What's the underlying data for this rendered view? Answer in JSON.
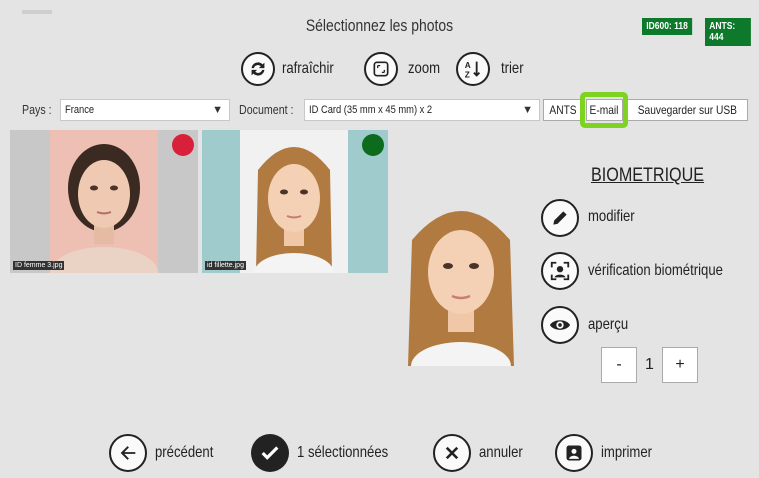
{
  "header": {
    "title": "Sélectionnez les photos",
    "badge_id600": "ID600: 118",
    "badge_ants": "ANTS: 444"
  },
  "toolbar": {
    "refresh_label": "rafraîchir",
    "zoom_label": "zoom",
    "sort_label": "trier"
  },
  "filters": {
    "country_label": "Pays :",
    "country_value": "France",
    "document_label": "Document :",
    "document_value": "ID Card (35 mm x 45 mm) x 2",
    "ants_button": "ANTS",
    "email_button": "E-mail",
    "usb_button": "Sauvegarder sur USB"
  },
  "thumbnails": [
    {
      "caption": "ID femme 3.jpg",
      "status_color": "#d9203a"
    },
    {
      "caption": "id fillette.jpg",
      "status_color": "#0c6b1c"
    }
  ],
  "panel": {
    "section_title": "BIOMETRIQUE",
    "edit_label": "modifier",
    "bio_check_label": "vérification biométrique",
    "preview_label": "aperçu",
    "quantity": "1",
    "minus": "-",
    "plus": "+"
  },
  "footer": {
    "previous_label": "précédent",
    "selected_label": "1 sélectionnées",
    "cancel_label": "annuler",
    "print_label": "imprimer"
  },
  "colors": {
    "highlight": "#7ed321",
    "badge": "#0c7a2a"
  }
}
